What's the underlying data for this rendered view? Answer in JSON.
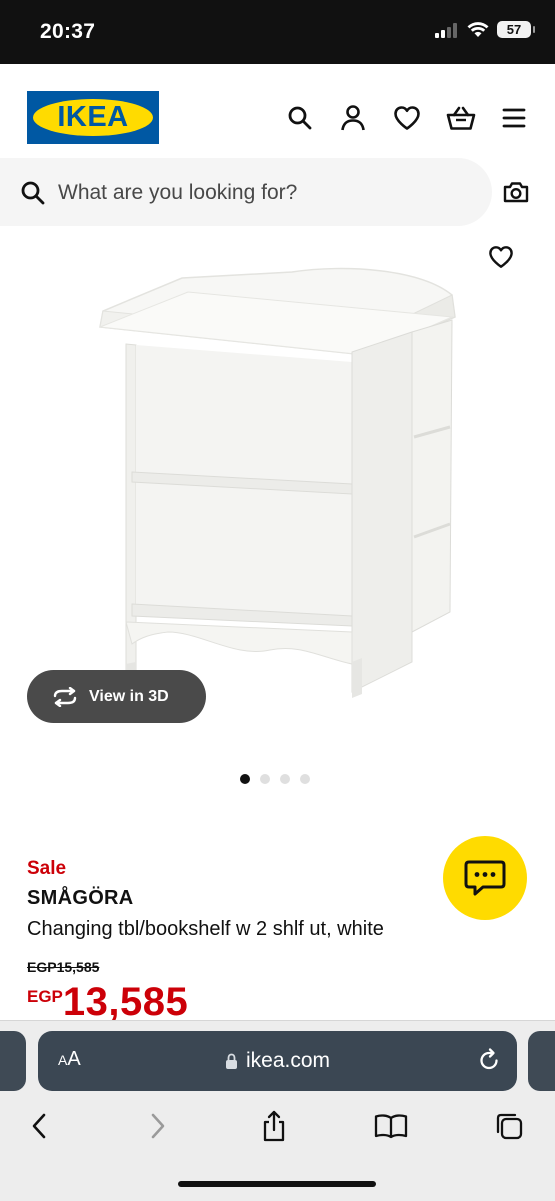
{
  "status_bar": {
    "time": "20:37",
    "battery": "57"
  },
  "header": {
    "logo_text": "IKEA",
    "icons": [
      "search-icon",
      "user-icon",
      "heart-icon",
      "basket-icon",
      "menu-icon"
    ]
  },
  "search": {
    "placeholder": "What are you looking for?"
  },
  "gallery": {
    "view_3d_label": "View in 3D",
    "dots_total": 4,
    "active_dot": 1
  },
  "product": {
    "badge": "Sale",
    "name": "SMÅGÖRA",
    "description": "Changing tbl/bookshelf w 2 shlf ut, white",
    "old_price": "EGP15,585",
    "price_currency": "EGP",
    "price_value": "13,585"
  },
  "browser": {
    "text_size_label_small": "A",
    "text_size_label_large": "A",
    "url": "ikea.com"
  },
  "colors": {
    "ikea_blue": "#0058a3",
    "ikea_yellow": "#ffdb00",
    "sale_red": "#cc0008",
    "address_bar": "#3b4753"
  }
}
